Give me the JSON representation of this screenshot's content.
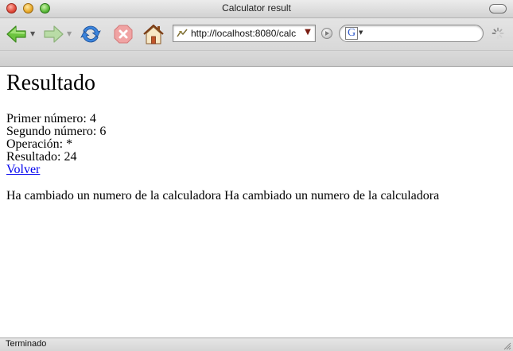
{
  "window": {
    "title": "Calculator result"
  },
  "toolbar": {
    "back_icon": "back-arrow-icon",
    "forward_icon": "forward-arrow-icon",
    "reload_icon": "reload-icon",
    "stop_icon": "stop-icon",
    "home_icon": "home-icon",
    "url": "http://localhost:8080/calc",
    "search_engine_glyph": "G",
    "search_placeholder": ""
  },
  "page": {
    "heading": "Resultado",
    "first_number": "Primer número: 4",
    "second_number": "Segundo número: 6",
    "operation": "Operación: *",
    "result": "Resultado: 24",
    "back_link": "Volver",
    "message": "Ha cambiado un numero de la calculadora Ha cambiado un numero de la calculadora"
  },
  "status": {
    "text": "Terminado"
  },
  "colors": {
    "link": "#0000ee",
    "back_arrow": "#5ab435",
    "reload": "#3b7fd6",
    "stop": "#e86a6a"
  }
}
